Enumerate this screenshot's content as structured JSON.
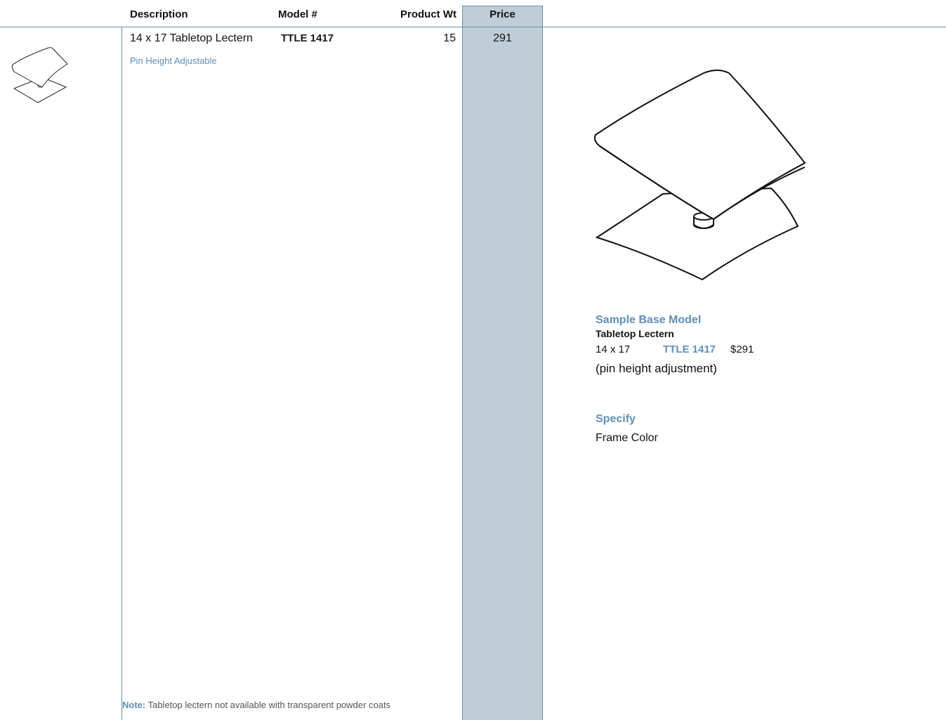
{
  "table": {
    "headers": {
      "description": "Description",
      "model": "Model #",
      "weight": "Product Wt",
      "price": "Price"
    },
    "rows": [
      {
        "description": "14 x 17 Tabletop Lectern",
        "option": "Pin Height Adjustable",
        "model": "TTLE 1417",
        "weight": "15",
        "price": "291"
      }
    ]
  },
  "sample": {
    "heading": "Sample Base Model",
    "product": "Tabletop Lectern",
    "size": "14 x 17",
    "model": "TTLE 1417",
    "price": "$291",
    "adjustment": "(pin height adjustment)"
  },
  "specify": {
    "heading": "Specify",
    "item": "Frame Color"
  },
  "note": {
    "label": "Note:",
    "text": " Tabletop lectern not available with transparent powder coats"
  },
  "colors": {
    "accent": "#5f8fb8",
    "price_column": "#bfcdd8",
    "rule": "#6a8fb0"
  },
  "icons": [
    "lectern-thumbnail-icon",
    "lectern-illustration"
  ]
}
